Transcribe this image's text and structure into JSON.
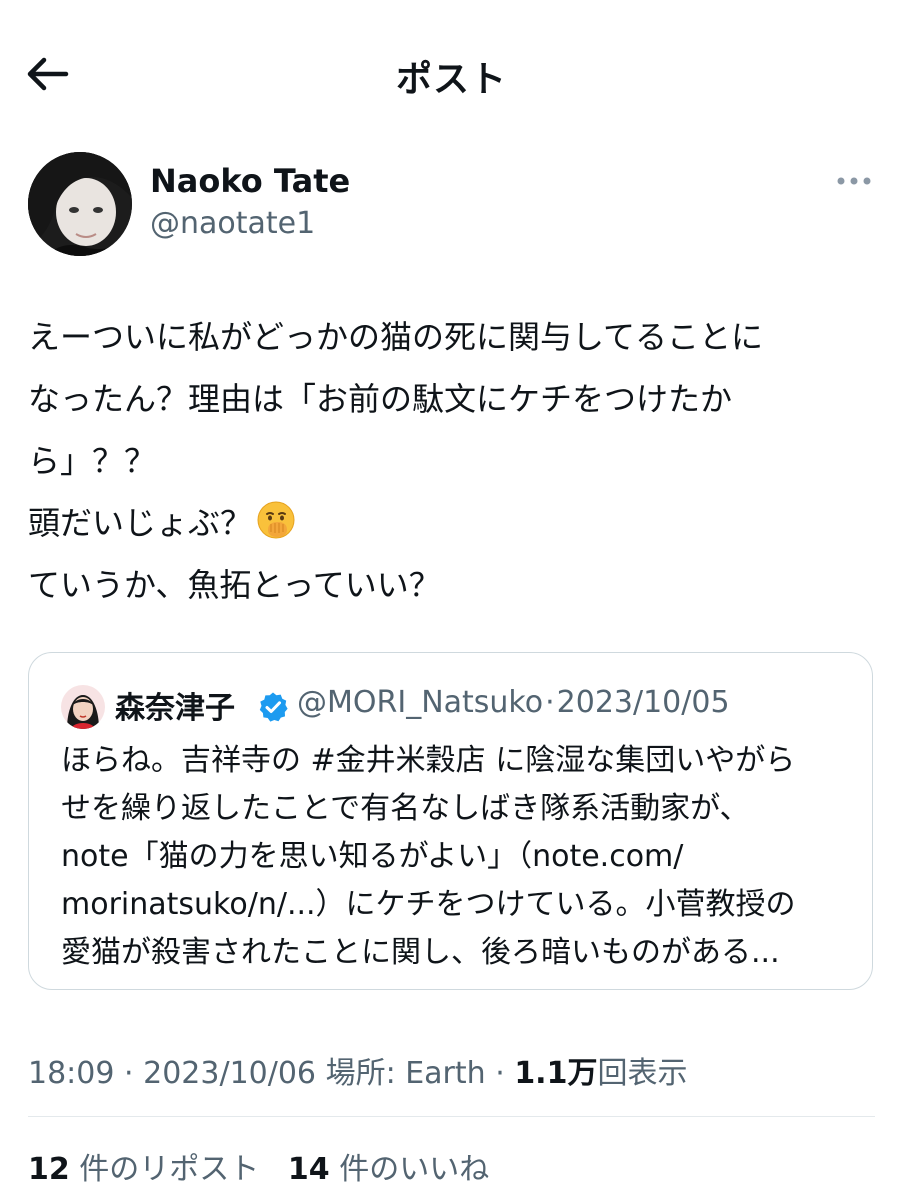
{
  "header": {
    "title": "ポスト"
  },
  "author": {
    "name": "Naoko Tate",
    "handle": "@naotate1"
  },
  "tweet": {
    "lines": [
      "えーついに私がどっかの猫の死に関与してることに",
      "なったん？理由は「お前の駄文にケチをつけたか",
      "ら」？？",
      "頭だいじょぶ？",
      "ていうか、魚拓とっていい？"
    ],
    "emoji": "face-with-hand-over-mouth"
  },
  "quote": {
    "name": "森奈津子",
    "handle": "@MORI_Natsuko",
    "separator": "·",
    "date": "2023/10/05",
    "lines": [
      "ほらね。吉祥寺の #金井米穀店 に陰湿な集団いやがら",
      "せを繰り返したことで有名なしばき隊系活動家が、",
      "note「猫の力を思い知るがよい」（note.com/",
      "morinatsuko/n/...）にケチをつけている。小菅教授の",
      "愛猫が殺害されたことに関し、後ろ暗いものがある..."
    ],
    "verified_color": "#1d9bf0"
  },
  "meta": {
    "time": "18:09",
    "separator": "·",
    "date": "2023/10/06",
    "location_label": "場所: Earth",
    "views_count": "1.1万",
    "views_label": "回表示"
  },
  "stats": {
    "reposts_count": "12",
    "reposts_label": "件のリポスト",
    "likes_count": "14",
    "likes_label": "件のいいね"
  },
  "colors": {
    "text": "#0f1419",
    "secondary": "#536471",
    "border": "#cfd9de",
    "accent": "#1d9bf0"
  }
}
